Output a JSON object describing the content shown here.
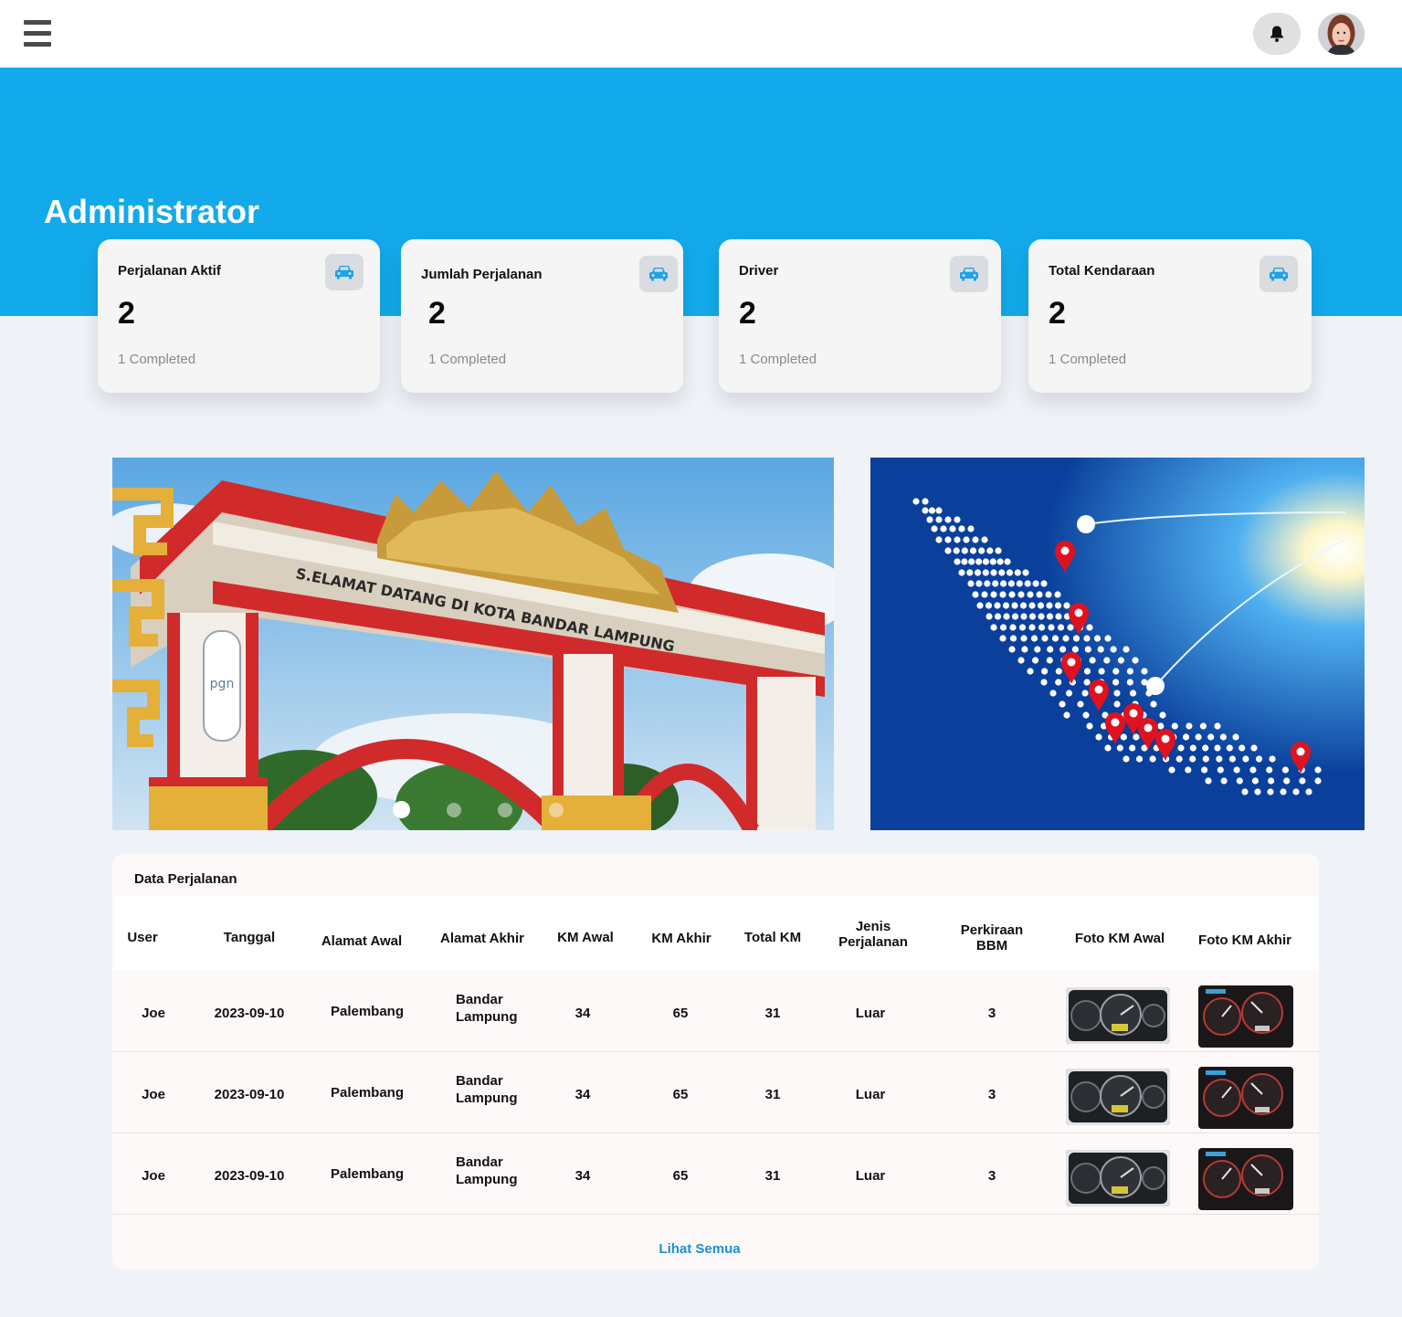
{
  "header": {
    "menu_icon": "hamburger-menu-icon",
    "notification_icon": "bell-icon",
    "avatar_icon": "user-avatar"
  },
  "hero": {
    "title": "Administrator"
  },
  "stats": [
    {
      "label": "Perjalanan Aktif",
      "value": "2",
      "sub": "1 Completed",
      "icon": "car-icon"
    },
    {
      "label": "Jumlah Perjalanan",
      "value": "2",
      "sub": "1 Completed",
      "icon": "car-icon"
    },
    {
      "label": "Driver",
      "value": "2",
      "sub": "1 Completed",
      "icon": "car-icon"
    },
    {
      "label": "Total Kendaraan",
      "value": "2",
      "sub": "1 Completed",
      "icon": "car-icon"
    }
  ],
  "carousel": {
    "slide_count": 4,
    "active_index": 0,
    "left_image_text": {
      "line1": "S.ELAMAT DATANG DI KOTA BANDAR LAMPUNG",
      "logo": "pgn"
    }
  },
  "colors": {
    "hero": "#13aaeb",
    "accent_icon": "#1ba4e6",
    "link": "#1b8fd6",
    "pin": "#e0121f"
  },
  "table": {
    "title": "Data Perjalanan",
    "columns": {
      "user": "User",
      "tanggal": "Tanggal",
      "alamat_awal": "Alamat Awal",
      "alamat_akhir": "Alamat Akhir",
      "km_awal": "KM Awal",
      "km_akhir": "KM Akhir",
      "total_km": "Total KM",
      "jenis_1": "Jenis",
      "jenis_2": "Perjalanan",
      "bbm_1": "Perkiraan",
      "bbm_2": "BBM",
      "foto_awal": "Foto KM Awal",
      "foto_akhir": "Foto KM Akhir"
    },
    "rows": [
      {
        "user": "Joe",
        "tanggal": "2023-09-10",
        "alamat_awal": "Palembang",
        "alamat_akhir_1": "Bandar",
        "alamat_akhir_2": "Lampung",
        "km_awal": "34",
        "km_akhir": "65",
        "total_km": "31",
        "jenis": "Luar",
        "bbm": "3"
      },
      {
        "user": "Joe",
        "tanggal": "2023-09-10",
        "alamat_awal": "Palembang",
        "alamat_akhir_1": "Bandar",
        "alamat_akhir_2": "Lampung",
        "km_awal": "34",
        "km_akhir": "65",
        "total_km": "31",
        "jenis": "Luar",
        "bbm": "3"
      },
      {
        "user": "Joe",
        "tanggal": "2023-09-10",
        "alamat_awal": "Palembang",
        "alamat_akhir_1": "Bandar",
        "alamat_akhir_2": "Lampung",
        "km_awal": "34",
        "km_akhir": "65",
        "total_km": "31",
        "jenis": "Luar",
        "bbm": "3"
      }
    ],
    "see_all": "Lihat Semua"
  }
}
